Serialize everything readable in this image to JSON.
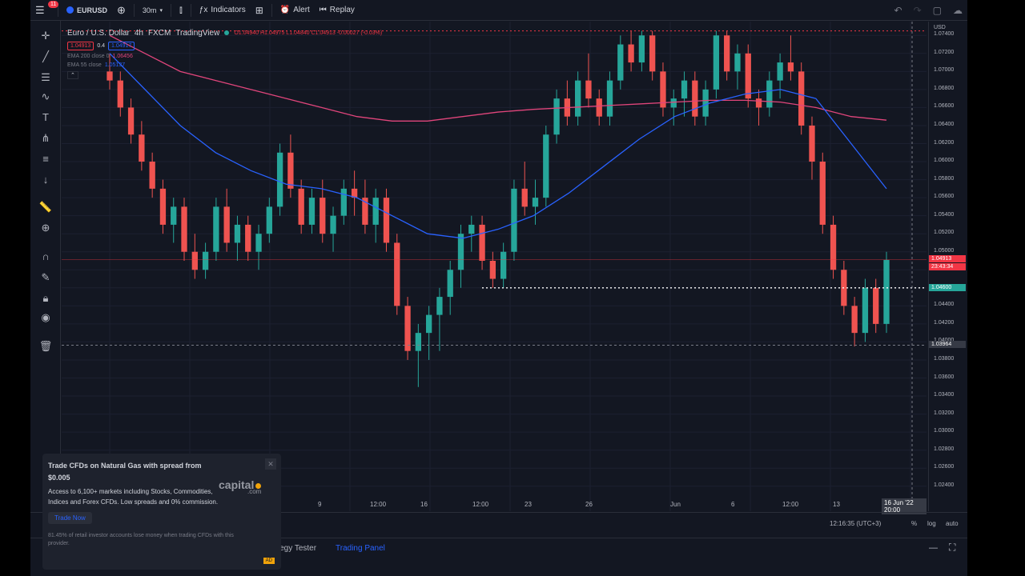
{
  "toolbar": {
    "notification_count": "11",
    "symbol": "EURUSD",
    "interval": "30m",
    "indicators": "Indicators",
    "alert": "Alert",
    "replay": "Replay"
  },
  "legend": {
    "title": "Euro / U.S. Dollar",
    "timeframe": "4h",
    "exchange": "FXCM",
    "source": "TradingView",
    "ohlc": "O1.04940 H1.04975 L1.04840 C1.04913 -0.00027 (-0.03%)",
    "sell_price": "1.04913",
    "spread": "0.4",
    "buy_price": "1.04917",
    "ema1_label": "EMA 200 close 0",
    "ema1_value": "1.06456",
    "ema2_label": "EMA 55 close",
    "ema2_value": "1.05137"
  },
  "price_axis": {
    "currency": "USD",
    "labels": [
      "1.07400",
      "1.07200",
      "1.07000",
      "1.06800",
      "1.06600",
      "1.06400",
      "1.06200",
      "1.06000",
      "1.05800",
      "1.05600",
      "1.05400",
      "1.05200",
      "1.05000",
      "1.04800",
      "1.04600",
      "1.04400",
      "1.04200",
      "1.04000",
      "1.03800",
      "1.03600",
      "1.03400",
      "1.03200",
      "1.03000",
      "1.02800",
      "1.02600",
      "1.02400"
    ],
    "current_price": "1.04913",
    "countdown": "23:43:34",
    "level_price": "1.04600",
    "crosshair_price": "1.03964"
  },
  "time_axis": {
    "labels": [
      "9",
      "12:00",
      "16",
      "12:00",
      "23",
      "26",
      "Jun",
      "6",
      "12:00",
      "13"
    ],
    "crosshair_date": "16 Jun '22",
    "crosshair_time": "20:00"
  },
  "status": {
    "clock": "12:16:35 (UTC+3)",
    "percent": "%",
    "log": "log",
    "auto": "auto"
  },
  "bottom_tabs": {
    "strategy_tester": "Strategy Tester",
    "trading_panel": "Trading Panel"
  },
  "promo": {
    "title": "Trade CFDs on Natural Gas with spread from $0.005",
    "body": "Access to 6,100+ markets including Stocks, Commodities, Indices and Forex CFDs. Low spreads and 0% commission.",
    "button": "Trade Now",
    "logo": "capital",
    "logo_suffix": ".com",
    "footer": "81.45% of retail investor accounts lose money when trading CFDs with this provider.",
    "ad": "AD"
  },
  "colors": {
    "bull": "#26a69a",
    "bear": "#ef5350",
    "ema200": "#e0457b",
    "ema55": "#2962ff",
    "accent": "#2962ff"
  },
  "chart_data": {
    "type": "candlestick",
    "title": "Euro / U.S. Dollar",
    "ylim": [
      1.023,
      1.075
    ],
    "y_axis": "right",
    "grid": true,
    "candles": [
      [
        1.07,
        1.072,
        1.068,
        1.069
      ],
      [
        1.069,
        1.07,
        1.065,
        1.066
      ],
      [
        1.066,
        1.067,
        1.062,
        1.063
      ],
      [
        1.063,
        1.0645,
        1.059,
        1.06
      ],
      [
        1.06,
        1.061,
        1.056,
        1.057
      ],
      [
        1.057,
        1.058,
        1.052,
        1.053
      ],
      [
        1.053,
        1.056,
        1.051,
        1.055
      ],
      [
        1.055,
        1.056,
        1.049,
        1.05
      ],
      [
        1.05,
        1.052,
        1.047,
        1.048
      ],
      [
        1.048,
        1.051,
        1.047,
        1.05
      ],
      [
        1.05,
        1.056,
        1.049,
        1.055
      ],
      [
        1.055,
        1.057,
        1.05,
        1.051
      ],
      [
        1.051,
        1.054,
        1.049,
        1.053
      ],
      [
        1.053,
        1.054,
        1.049,
        1.05
      ],
      [
        1.05,
        1.053,
        1.048,
        1.052
      ],
      [
        1.052,
        1.056,
        1.051,
        1.055
      ],
      [
        1.055,
        1.062,
        1.054,
        1.061
      ],
      [
        1.061,
        1.063,
        1.056,
        1.057
      ],
      [
        1.057,
        1.058,
        1.052,
        1.053
      ],
      [
        1.053,
        1.057,
        1.052,
        1.056
      ],
      [
        1.056,
        1.058,
        1.051,
        1.052
      ],
      [
        1.052,
        1.055,
        1.05,
        1.054
      ],
      [
        1.054,
        1.058,
        1.053,
        1.057
      ],
      [
        1.057,
        1.059,
        1.054,
        1.056
      ],
      [
        1.056,
        1.058,
        1.052,
        1.053
      ],
      [
        1.053,
        1.057,
        1.051,
        1.056
      ],
      [
        1.056,
        1.057,
        1.05,
        1.051
      ],
      [
        1.051,
        1.052,
        1.043,
        1.044
      ],
      [
        1.044,
        1.045,
        1.038,
        1.039
      ],
      [
        1.039,
        1.042,
        1.035,
        1.041
      ],
      [
        1.041,
        1.044,
        1.038,
        1.043
      ],
      [
        1.043,
        1.046,
        1.039,
        1.045
      ],
      [
        1.045,
        1.049,
        1.043,
        1.048
      ],
      [
        1.048,
        1.053,
        1.046,
        1.052
      ],
      [
        1.052,
        1.054,
        1.05,
        1.053
      ],
      [
        1.053,
        1.054,
        1.048,
        1.049
      ],
      [
        1.049,
        1.05,
        1.046,
        1.047
      ],
      [
        1.047,
        1.051,
        1.046,
        1.05
      ],
      [
        1.05,
        1.058,
        1.049,
        1.057
      ],
      [
        1.057,
        1.06,
        1.054,
        1.055
      ],
      [
        1.055,
        1.058,
        1.053,
        1.056
      ],
      [
        1.056,
        1.064,
        1.055,
        1.063
      ],
      [
        1.063,
        1.068,
        1.062,
        1.067
      ],
      [
        1.067,
        1.069,
        1.064,
        1.065
      ],
      [
        1.065,
        1.07,
        1.064,
        1.069
      ],
      [
        1.069,
        1.072,
        1.066,
        1.067
      ],
      [
        1.067,
        1.068,
        1.064,
        1.065
      ],
      [
        1.065,
        1.07,
        1.064,
        1.069
      ],
      [
        1.069,
        1.074,
        1.068,
        1.073
      ],
      [
        1.073,
        1.0745,
        1.07,
        1.071
      ],
      [
        1.071,
        1.0745,
        1.07,
        1.074
      ],
      [
        1.074,
        1.0745,
        1.069,
        1.07
      ],
      [
        1.07,
        1.071,
        1.065,
        1.066
      ],
      [
        1.066,
        1.068,
        1.064,
        1.067
      ],
      [
        1.067,
        1.07,
        1.065,
        1.069
      ],
      [
        1.069,
        1.07,
        1.064,
        1.065
      ],
      [
        1.065,
        1.069,
        1.064,
        1.068
      ],
      [
        1.068,
        1.0745,
        1.067,
        1.074
      ],
      [
        1.074,
        1.0745,
        1.069,
        1.07
      ],
      [
        1.07,
        1.073,
        1.068,
        1.072
      ],
      [
        1.072,
        1.073,
        1.066,
        1.067
      ],
      [
        1.067,
        1.068,
        1.064,
        1.066
      ],
      [
        1.066,
        1.07,
        1.065,
        1.069
      ],
      [
        1.069,
        1.072,
        1.067,
        1.071
      ],
      [
        1.071,
        1.074,
        1.069,
        1.07
      ],
      [
        1.07,
        1.071,
        1.063,
        1.064
      ],
      [
        1.064,
        1.065,
        1.058,
        1.06
      ],
      [
        1.06,
        1.061,
        1.052,
        1.053
      ],
      [
        1.053,
        1.054,
        1.047,
        1.048
      ],
      [
        1.048,
        1.049,
        1.043,
        1.044
      ],
      [
        1.044,
        1.045,
        1.0395,
        1.041
      ],
      [
        1.041,
        1.047,
        1.04,
        1.046
      ],
      [
        1.046,
        1.047,
        1.041,
        1.042
      ],
      [
        1.042,
        1.05,
        1.041,
        1.0491
      ]
    ],
    "ema200": [
      1.074,
      1.072,
      1.07,
      1.069,
      1.068,
      1.067,
      1.066,
      1.065,
      1.0645,
      1.0645,
      1.065,
      1.0655,
      1.0658,
      1.066,
      1.0662,
      1.0664,
      1.0666,
      1.0668,
      1.0668,
      1.0666,
      1.066,
      1.065,
      1.0646
    ],
    "ema55": [
      1.072,
      1.068,
      1.064,
      1.061,
      1.059,
      1.0575,
      1.057,
      1.056,
      1.054,
      1.052,
      1.0515,
      1.0525,
      1.054,
      1.0565,
      1.0595,
      1.0625,
      1.065,
      1.0665,
      1.0675,
      1.068,
      1.067,
      1.062,
      1.057
    ],
    "horizontal_levels": [
      1.04913,
      1.046,
      1.03964
    ]
  }
}
